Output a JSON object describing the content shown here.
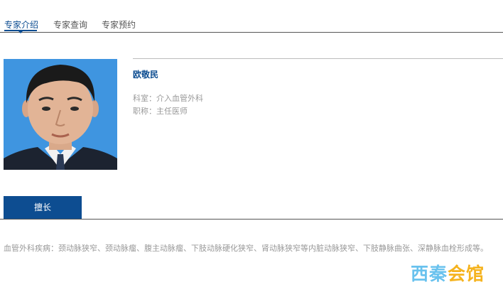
{
  "tabs": [
    {
      "label": "专家介绍"
    },
    {
      "label": "专家查询"
    },
    {
      "label": "专家预约"
    }
  ],
  "doctor": {
    "name": "欧敬民",
    "department": "科室：介入血管外科",
    "title": "职称：主任医师"
  },
  "section": {
    "tab_label": "擅长",
    "specialty": "血管外科疾病：颈动脉狭窄、颈动脉瘤、腹主动脉瘤、下肢动脉硬化狭窄、肾动脉狭窄等内脏动脉狭窄、下肢静脉曲张、深静脉血栓形成等。"
  },
  "watermark": {
    "part1": "西秦",
    "part2": "会馆"
  },
  "colors": {
    "accent": "#0d4d91",
    "photo_background": "#3f95e0",
    "watermark_blue": "#69c2ee",
    "watermark_orange": "#f5b31e"
  }
}
